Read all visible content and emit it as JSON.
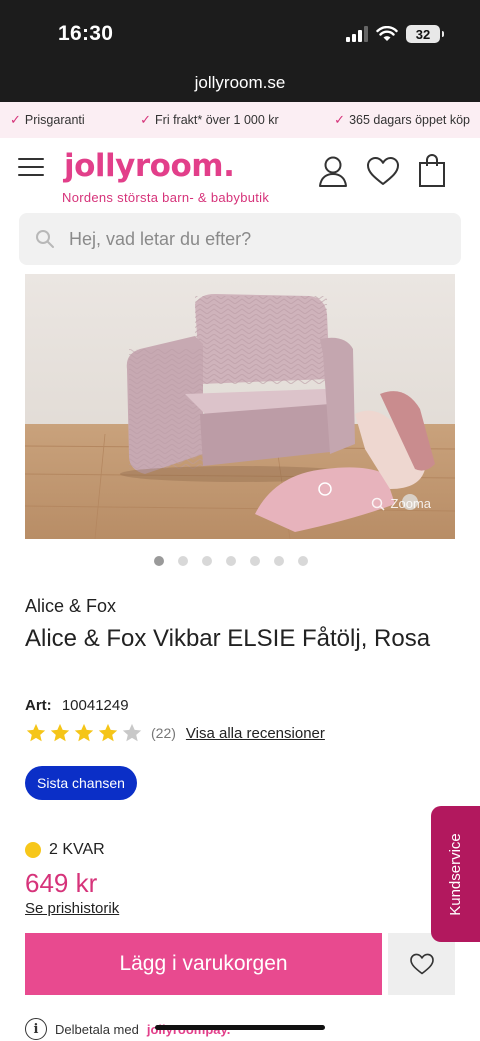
{
  "status_bar": {
    "time": "16:30",
    "battery": "32"
  },
  "browser": {
    "url": "jollyroom.se"
  },
  "usp": [
    {
      "text": "Prisgaranti"
    },
    {
      "text": "Fri frakt* över 1 000 kr"
    },
    {
      "text": "365 dagars öppet köp"
    }
  ],
  "header": {
    "logo": "jollyroom.",
    "tagline": "Nordens största barn- & babybutik"
  },
  "search": {
    "placeholder": "Hej, vad letar du efter?"
  },
  "gallery": {
    "zoom_label": "Zooma",
    "image_count": 7,
    "active_index": 0
  },
  "product": {
    "brand": "Alice & Fox",
    "title": "Alice & Fox Vikbar ELSIE Fåtölj, Rosa",
    "art_label": "Art:",
    "art_number": "10041249",
    "rating": 4,
    "rating_max": 5,
    "review_count": "(22)",
    "review_link": "Visa alla recensioner",
    "badge": "Sista chansen",
    "stock": "2 KVAR",
    "price": "649 kr",
    "price_history": "Se prishistorik",
    "add_to_cart": "Lägg i varukorgen"
  },
  "side_tab": {
    "label": "Kundservice"
  },
  "footer": {
    "installment_text": "Delbetala med",
    "pay_logo": "jollyroompay."
  },
  "colors": {
    "brand_pink": "#e23f8a",
    "button_pink": "#e84a8f",
    "badge_blue": "#0b2fc7",
    "side_tab": "#b2185e",
    "star": "#f5c518"
  }
}
